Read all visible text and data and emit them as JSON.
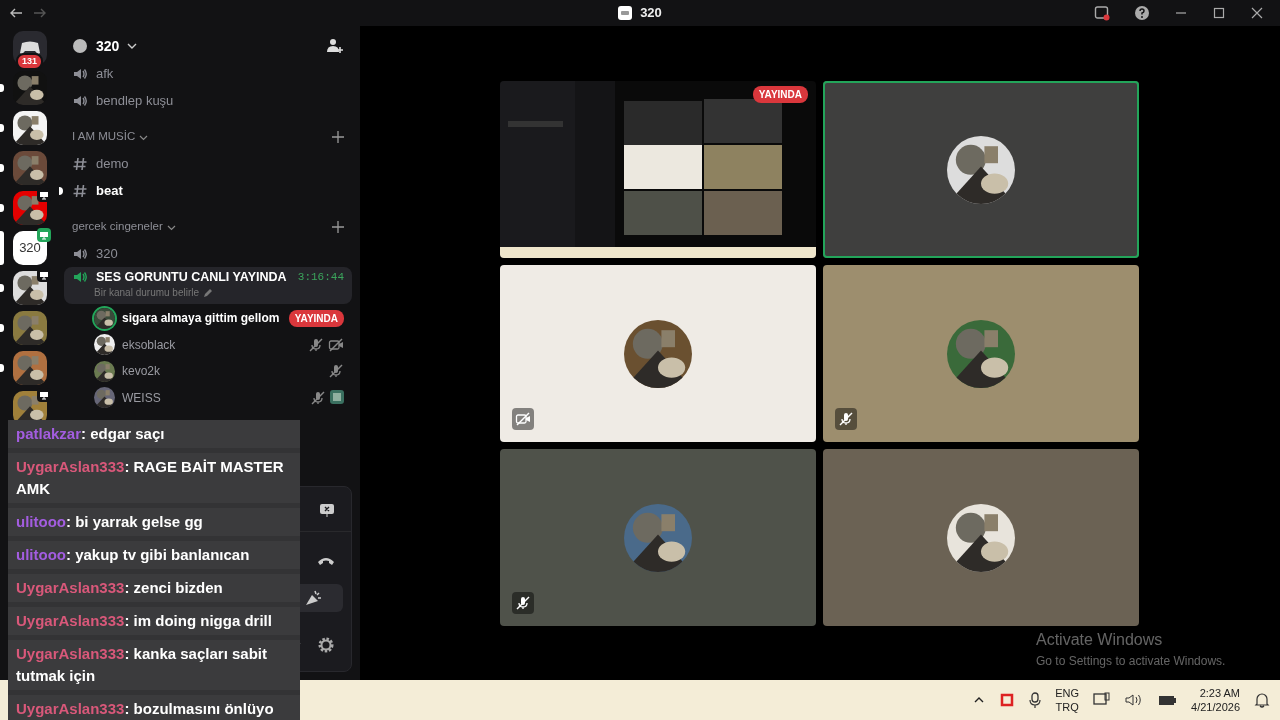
{
  "title_bar": {
    "title": "320"
  },
  "servers": [
    {
      "kind": "dm",
      "badge": "131",
      "unread": false,
      "selected": false,
      "live": false
    },
    {
      "kind": "picture",
      "unread": true,
      "selected": false,
      "live": false
    },
    {
      "kind": "picture",
      "unread": true,
      "selected": false,
      "live": false
    },
    {
      "kind": "picture",
      "unread": true,
      "selected": false,
      "live": false
    },
    {
      "kind": "picture",
      "unread": true,
      "selected": false,
      "live": true
    },
    {
      "kind": "text",
      "label": "320",
      "unread": false,
      "selected": true,
      "live": true
    },
    {
      "kind": "picture",
      "unread": true,
      "selected": false,
      "live": true
    },
    {
      "kind": "picture",
      "unread": true,
      "selected": false,
      "live": false
    },
    {
      "kind": "picture",
      "unread": true,
      "selected": false,
      "live": false
    },
    {
      "kind": "picture",
      "unread": false,
      "selected": false,
      "live": true
    }
  ],
  "server_name": "320",
  "channels": [
    {
      "kind": "voice",
      "name": "afk",
      "selected": false,
      "unread": false
    },
    {
      "kind": "voice",
      "name": "bendlep kuşu",
      "selected": false,
      "unread": false
    },
    {
      "kind": "category",
      "name": "I AM MUSİC"
    },
    {
      "kind": "text",
      "name": "demo",
      "selected": false,
      "unread": false
    },
    {
      "kind": "text",
      "name": "beat",
      "selected": false,
      "unread": true
    },
    {
      "kind": "category",
      "name": "gercek cingeneler"
    },
    {
      "kind": "voice",
      "name": "320",
      "selected": false,
      "unread": false
    },
    {
      "kind": "voice",
      "name": "SES GORUNTU CANLI YAYINDA",
      "selected": true,
      "unread": false,
      "timer": "3:16:44",
      "status": "Bir kanal durumu belirle",
      "members": [
        {
          "name": "sigara almaya gittim gellom",
          "speaking": true,
          "live_badge": "YAYINDA",
          "mic_muted": false,
          "video_off": false
        },
        {
          "name": "eksoblack",
          "speaking": false,
          "mic_muted": true,
          "video_off": true
        },
        {
          "name": "kevo2k",
          "speaking": false,
          "mic_muted": true,
          "video_off": false
        },
        {
          "name": "WEISS",
          "speaking": false,
          "mic_muted": true,
          "video_off": false,
          "activity": true
        }
      ]
    }
  ],
  "tiles": [
    {
      "kind": "stream",
      "badge": "YAYINDA",
      "speaking": false
    },
    {
      "kind": "avatar",
      "color": "#3f3f3e",
      "speaking": true,
      "mic_muted": false,
      "video_off": false
    },
    {
      "kind": "avatar",
      "color": "#efebe5",
      "speaking": false,
      "mic_muted": false,
      "video_off": true
    },
    {
      "kind": "avatar",
      "color": "#9d8e6e",
      "speaking": false,
      "mic_muted": true,
      "video_off": false
    },
    {
      "kind": "avatar",
      "color": "#4f524a",
      "speaking": false,
      "mic_muted": true,
      "video_off": false
    },
    {
      "kind": "avatar",
      "color": "#6b6254",
      "speaking": false,
      "mic_muted": false,
      "video_off": false
    }
  ],
  "activation": {
    "title": "Activate Windows",
    "text": "Go to Settings to activate Windows."
  },
  "chat_overlay": [
    {
      "user": "patlakzar",
      "color": "#a35de0",
      "text": ": edgar saçı"
    },
    {
      "user": "UygarAslan333",
      "color": "#d9587a",
      "text": ": RAGE BAİT MASTER AMK"
    },
    {
      "user": "ulitooo",
      "color": "#a35de0",
      "text": ": bi yarrak gelse gg"
    },
    {
      "user": "ulitooo",
      "color": "#a35de0",
      "text": ": yakup tv gibi banlanıcan"
    },
    {
      "user": "UygarAslan333",
      "color": "#d9587a",
      "text": ": zenci bizden"
    },
    {
      "user": "UygarAslan333",
      "color": "#d9587a",
      "text": ": im doing nigga drill"
    },
    {
      "user": "UygarAslan333",
      "color": "#d9587a",
      "text": ": kanka saçları sabit tutmak için"
    },
    {
      "user": "UygarAslan333",
      "color": "#d9587a",
      "text": ": bozulmasını önlüyo"
    }
  ],
  "tray": {
    "language": "ENG",
    "layout": "TRQ",
    "time": "2:23 AM",
    "date": "4/21/2026"
  }
}
